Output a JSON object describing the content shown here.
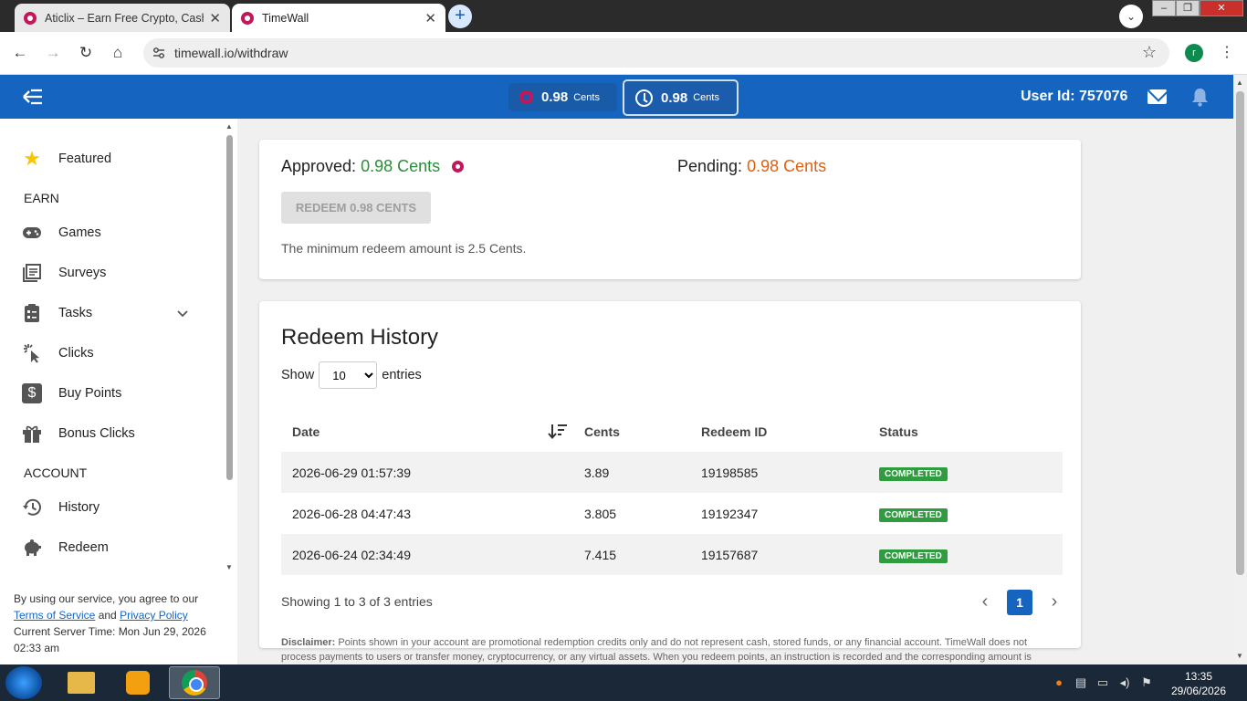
{
  "browser": {
    "tabs": [
      {
        "label": "Aticlix – Earn Free Crypto, Cash"
      },
      {
        "label": "TimeWall"
      }
    ],
    "url": "timewall.io/withdraw",
    "profile_initial": "r"
  },
  "header": {
    "approved_balance": "0.98",
    "pending_balance": "0.98",
    "unit": "Cents",
    "user_id": "User Id: 757076"
  },
  "sidebar": {
    "featured": "Featured",
    "earn_heading": "EARN",
    "earn_items": [
      "Games",
      "Surveys",
      "Tasks",
      "Clicks",
      "Buy Points",
      "Bonus Clicks"
    ],
    "account_heading": "ACCOUNT",
    "account_items": [
      "History",
      "Redeem"
    ],
    "footer": {
      "agree_text": "By using our service, you agree to our",
      "terms": "Terms of Service",
      "and": "and",
      "privacy": "Privacy Policy",
      "server_time": "Current Server Time: Mon Jun 29, 2026 02:33 am"
    }
  },
  "balance_card": {
    "approved_label": "Approved:",
    "approved_value": "0.98 Cents",
    "pending_label": "Pending:",
    "pending_value": "0.98 Cents",
    "redeem_button": "REDEEM 0.98 CENTS",
    "min_note": "The minimum redeem amount is 2.5 Cents."
  },
  "history": {
    "title": "Redeem History",
    "show_label": "Show",
    "entries_value": "10",
    "entries_label": "entries",
    "columns": [
      "Date",
      "Cents",
      "Redeem ID",
      "Status"
    ],
    "rows": [
      {
        "date": "2026-06-29 01:57:39",
        "cents": "3.89",
        "id": "19198585",
        "status": "COMPLETED"
      },
      {
        "date": "2026-06-28 04:47:43",
        "cents": "3.805",
        "id": "19192347",
        "status": "COMPLETED"
      },
      {
        "date": "2026-06-24 02:34:49",
        "cents": "7.415",
        "id": "19157687",
        "status": "COMPLETED"
      }
    ],
    "showing": "Showing 1 to 3 of 3 entries",
    "page": "1"
  },
  "disclaimer": {
    "label": "Disclaimer:",
    "text": "Points shown in your account are promotional redemption credits only and do not represent cash, stored funds, or any financial account. TimeWall does not process payments to users or transfer money, cryptocurrency, or any virtual assets. When you redeem points, an instruction is recorded and the corresponding amount is"
  },
  "taskbar": {
    "time": "13:35",
    "date": "29/06/2026"
  },
  "colors": {
    "brand_blue": "#1565c0",
    "approved_green": "#2e8b3a",
    "pending_orange": "#e06010",
    "status_green": "#2e9c3f"
  }
}
